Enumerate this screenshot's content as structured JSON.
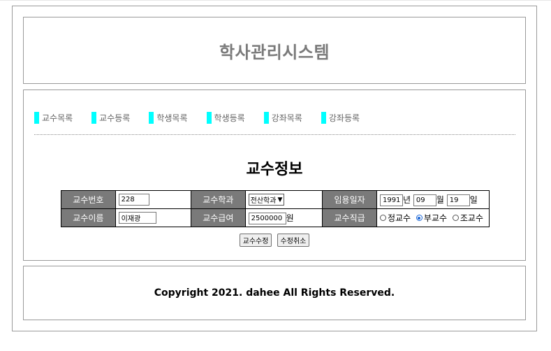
{
  "header": {
    "title": "학사관리시스템"
  },
  "nav": {
    "items": [
      {
        "label": "교수목록"
      },
      {
        "label": "교수등록"
      },
      {
        "label": "학생목록"
      },
      {
        "label": "학생등록"
      },
      {
        "label": "강좌목록"
      },
      {
        "label": "강좌등록"
      }
    ],
    "accent_color": "#00ffff"
  },
  "form": {
    "title": "교수정보",
    "row1": {
      "id_label": "교수번호",
      "id_value": "228",
      "dept_label": "교수학과",
      "dept_value": "전산학과",
      "hire_label": "임용일자",
      "year_value": "1991",
      "year_unit": "년",
      "month_value": "09",
      "month_unit": "월",
      "day_value": "19",
      "day_unit": "일"
    },
    "row2": {
      "name_label": "교수이름",
      "name_value": "이재광",
      "salary_label": "교수급여",
      "salary_value": "2500000",
      "salary_unit": "원",
      "rank_label": "교수직급",
      "rank_options": [
        "정교수",
        "부교수",
        "조교수"
      ],
      "rank_selected": "부교수"
    },
    "buttons": {
      "update": "교수수정",
      "cancel": "수정취소"
    },
    "label_bg": "#7a7a7a"
  },
  "footer": {
    "copyright": "Copyright 2021. dahee All Rights Reserved."
  }
}
